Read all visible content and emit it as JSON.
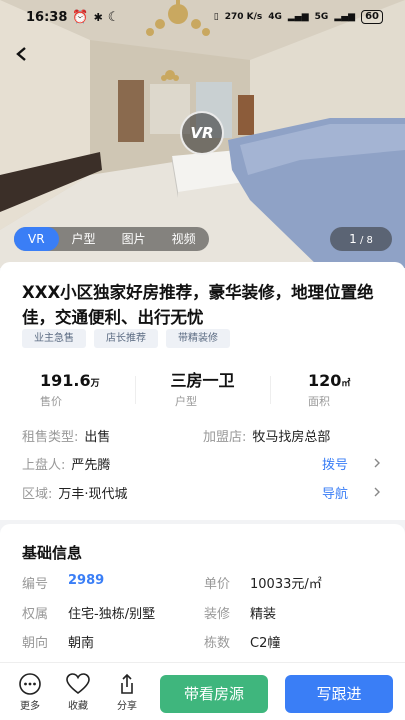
{
  "status": {
    "time": "16:38",
    "battery": "60",
    "net_speed": "270 K/s",
    "net_type": "4G",
    "net_type2": "5G"
  },
  "media": {
    "tabs": [
      "VR",
      "户型",
      "图片",
      "视频"
    ],
    "active_tab": "VR",
    "vr_badge": "VR",
    "counter_current": "1",
    "counter_total": " / 8"
  },
  "listing": {
    "title": "XXX小区独家好房推荐，豪华装修，地理位置绝佳，交通便利、出行无忧",
    "tags": [
      "业主急售",
      "店长推荐",
      "带精装修"
    ],
    "stats": [
      {
        "value": "191.6",
        "unit": "万",
        "label": "售价"
      },
      {
        "value": "三房一卫",
        "unit": "",
        "label": "户型"
      },
      {
        "value": "120",
        "unit": "㎡",
        "label": "面积"
      }
    ],
    "rent_sale_type_label": "租售类型:",
    "rent_sale_type": "出售",
    "store_label": "加盟店:",
    "store": "牧马找房总部",
    "listed_by_label": "上盘人:",
    "listed_by": "严先腾",
    "dial_label": "拨号",
    "area_label": "区域:",
    "area": "万丰·现代城",
    "navigate_label": "导航"
  },
  "basic_info": {
    "title": "基础信息",
    "rows": [
      {
        "k1": "编号",
        "v1": "2989",
        "k2": "单价",
        "v2": "10033元/㎡"
      },
      {
        "k1": "权属",
        "v1": "住宅-独栋/别墅",
        "k2": "装修",
        "v2": "精装"
      },
      {
        "k1": "朝向",
        "v1": "朝南",
        "k2": "栋数",
        "v2": "C2幢"
      }
    ]
  },
  "bottom_bar": {
    "more": "更多",
    "favorite": "收藏",
    "share": "分享",
    "tour_button": "带看房源",
    "followup_button": "写跟进"
  }
}
